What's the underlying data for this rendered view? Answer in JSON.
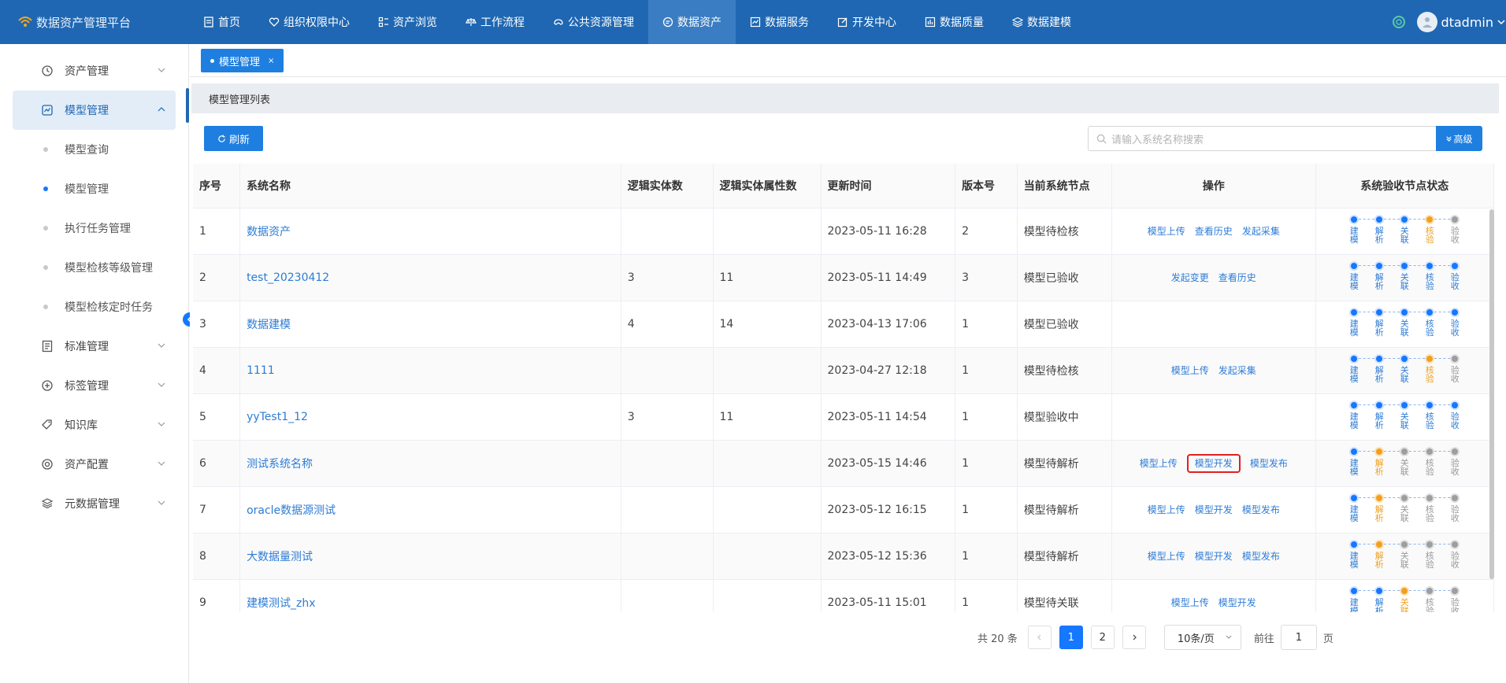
{
  "app": {
    "title": "数据资产管理平台"
  },
  "nav": {
    "items": [
      {
        "label": "首页",
        "icon": "document-icon"
      },
      {
        "label": "组织权限中心",
        "icon": "heart-icon"
      },
      {
        "label": "资产浏览",
        "icon": "grid-icon"
      },
      {
        "label": "工作流程",
        "icon": "scale-icon"
      },
      {
        "label": "公共资源管理",
        "icon": "gamepad-icon"
      },
      {
        "label": "数据资产",
        "icon": "chat-icon",
        "active": true
      },
      {
        "label": "数据服务",
        "icon": "chart-icon"
      },
      {
        "label": "开发中心",
        "icon": "edit-icon"
      },
      {
        "label": "数据质量",
        "icon": "bar-chart-icon"
      },
      {
        "label": "数据建模",
        "icon": "layers-icon"
      }
    ]
  },
  "user": {
    "name": "dtadmin"
  },
  "sidebar": {
    "groups": [
      {
        "label": "资产管理",
        "icon": "clock-icon"
      },
      {
        "label": "模型管理",
        "icon": "chart-box-icon",
        "active": true,
        "children": [
          {
            "label": "模型查询"
          },
          {
            "label": "模型管理",
            "active": true
          },
          {
            "label": "执行任务管理"
          },
          {
            "label": "模型检核等级管理"
          },
          {
            "label": "模型检核定时任务"
          }
        ]
      },
      {
        "label": "标准管理",
        "icon": "list-icon"
      },
      {
        "label": "标签管理",
        "icon": "plus-circle-icon"
      },
      {
        "label": "知识库",
        "icon": "tag-icon"
      },
      {
        "label": "资产配置",
        "icon": "target-icon"
      },
      {
        "label": "元数据管理",
        "icon": "stack-icon"
      }
    ]
  },
  "tabs": [
    {
      "label": "模型管理",
      "close": "×"
    }
  ],
  "section": {
    "title": "模型管理列表"
  },
  "toolbar": {
    "refresh_label": "刷新",
    "search_placeholder": "请输入系统名称搜索",
    "advanced_label": "高级"
  },
  "table": {
    "headers": [
      "序号",
      "系统名称",
      "逻辑实体数",
      "逻辑实体属性数",
      "更新时间",
      "版本号",
      "当前系统节点",
      "操作",
      "系统验收节点状态"
    ],
    "step_labels": [
      "建模",
      "解析",
      "关联",
      "核验",
      "验收"
    ],
    "rows": [
      {
        "idx": "1",
        "name": "数据资产",
        "entities": "",
        "attrs": "",
        "time": "2023-05-11 16:28",
        "ver": "2",
        "node": "模型待检核",
        "ops": [
          "模型上传",
          "查看历史",
          "发起采集"
        ],
        "states": [
          "done",
          "done",
          "done",
          "cur",
          "todo"
        ]
      },
      {
        "idx": "2",
        "name": "test_20230412",
        "entities": "3",
        "attrs": "11",
        "time": "2023-05-11 14:49",
        "ver": "3",
        "node": "模型已验收",
        "ops": [
          "发起变更",
          "查看历史"
        ],
        "states": [
          "done",
          "done",
          "done",
          "done",
          "done"
        ]
      },
      {
        "idx": "3",
        "name": "数据建模",
        "entities": "4",
        "attrs": "14",
        "time": "2023-04-13 17:06",
        "ver": "1",
        "node": "模型已验收",
        "ops": [],
        "states": [
          "done",
          "done",
          "done",
          "done",
          "done"
        ]
      },
      {
        "idx": "4",
        "name": "1111",
        "entities": "",
        "attrs": "",
        "time": "2023-04-27 12:18",
        "ver": "1",
        "node": "模型待检核",
        "ops": [
          "模型上传",
          "发起采集"
        ],
        "states": [
          "done",
          "done",
          "done",
          "cur",
          "todo"
        ]
      },
      {
        "idx": "5",
        "name": "yyTest1_12",
        "entities": "3",
        "attrs": "11",
        "time": "2023-05-11 14:54",
        "ver": "1",
        "node": "模型验收中",
        "ops": [],
        "states": [
          "done",
          "done",
          "done",
          "done",
          "done"
        ]
      },
      {
        "idx": "6",
        "name": "测试系统名称",
        "entities": "",
        "attrs": "",
        "time": "2023-05-15 14:46",
        "ver": "1",
        "node": "模型待解析",
        "ops": [
          "模型上传",
          "模型开发",
          "模型发布"
        ],
        "highlight": 1,
        "states": [
          "done",
          "cur",
          "todo",
          "todo",
          "todo"
        ]
      },
      {
        "idx": "7",
        "name": "oracle数据源测试",
        "entities": "",
        "attrs": "",
        "time": "2023-05-12 16:15",
        "ver": "1",
        "node": "模型待解析",
        "ops": [
          "模型上传",
          "模型开发",
          "模型发布"
        ],
        "states": [
          "done",
          "cur",
          "todo",
          "todo",
          "todo"
        ]
      },
      {
        "idx": "8",
        "name": "大数据量测试",
        "entities": "",
        "attrs": "",
        "time": "2023-05-12 15:36",
        "ver": "1",
        "node": "模型待解析",
        "ops": [
          "模型上传",
          "模型开发",
          "模型发布"
        ],
        "states": [
          "done",
          "cur",
          "todo",
          "todo",
          "todo"
        ]
      },
      {
        "idx": "9",
        "name": "建模测试_zhx",
        "entities": "",
        "attrs": "",
        "time": "2023-05-11 15:01",
        "ver": "1",
        "node": "模型待关联",
        "ops": [
          "模型上传",
          "模型开发"
        ],
        "states": [
          "done",
          "done",
          "cur",
          "todo",
          "todo"
        ]
      }
    ]
  },
  "pagination": {
    "total_text": "共 20 条",
    "pages": [
      "1",
      "2"
    ],
    "current": "1",
    "page_size": "10条/页",
    "goto_prefix": "前往",
    "goto_value": "1",
    "goto_suffix": "页"
  },
  "colors": {
    "primary": "#1f67b2",
    "accent": "#1677ff",
    "warning": "#f0a020",
    "highlight": "#e02020"
  }
}
